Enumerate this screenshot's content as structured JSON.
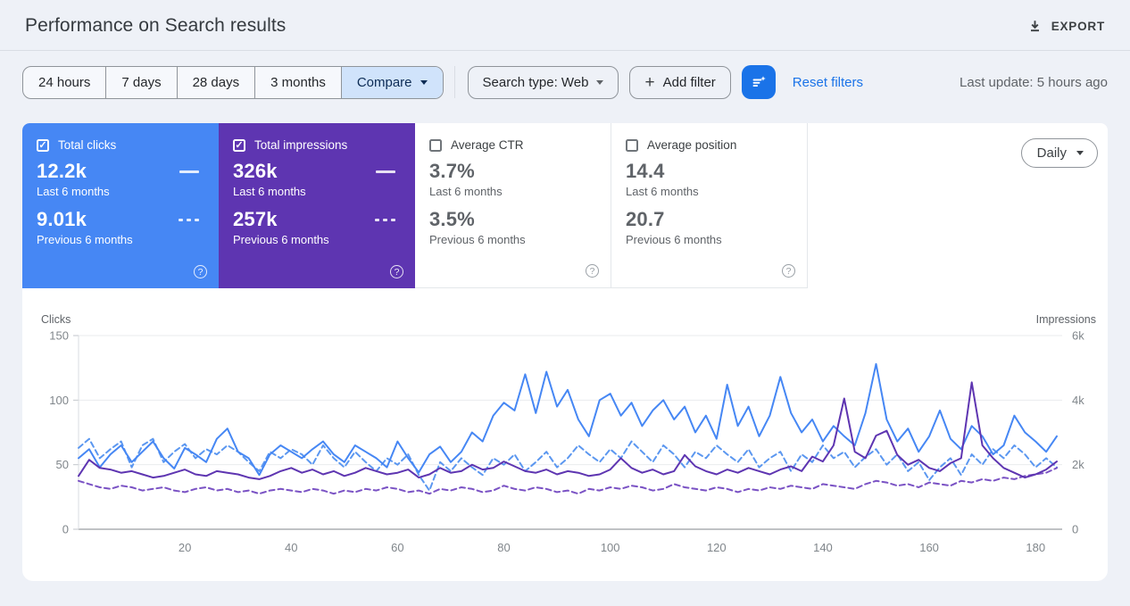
{
  "header": {
    "title": "Performance on Search results",
    "export_label": "EXPORT"
  },
  "filters": {
    "date_ranges": [
      "24 hours",
      "7 days",
      "28 days",
      "3 months"
    ],
    "compare_label": "Compare",
    "search_type_label": "Search type: Web",
    "add_filter_label": "Add filter",
    "reset_label": "Reset filters",
    "last_update": "Last update: 5 hours ago"
  },
  "granularity": {
    "label": "Daily"
  },
  "cards": [
    {
      "label": "Total clicks",
      "checked": true,
      "color": "#4687f4",
      "value_current": "12.2k",
      "period_current": "Last 6 months",
      "value_previous": "9.01k",
      "period_previous": "Previous 6 months"
    },
    {
      "label": "Total impressions",
      "checked": true,
      "color": "#5e35b1",
      "value_current": "326k",
      "period_current": "Last 6 months",
      "value_previous": "257k",
      "period_previous": "Previous 6 months"
    },
    {
      "label": "Average CTR",
      "checked": false,
      "value_current": "3.7%",
      "period_current": "Last 6 months",
      "value_previous": "3.5%",
      "period_previous": "Previous 6 months"
    },
    {
      "label": "Average position",
      "checked": false,
      "value_current": "14.4",
      "period_current": "Last 6 months",
      "value_previous": "20.7",
      "period_previous": "Previous 6 months"
    }
  ],
  "chart_data": {
    "type": "line",
    "left_axis": {
      "title": "Clicks",
      "ticks": [
        "0",
        "50",
        "100",
        "150"
      ],
      "range": [
        0,
        150
      ]
    },
    "right_axis": {
      "title": "Impressions",
      "ticks": [
        "0",
        "2k",
        "4k",
        "6k"
      ],
      "range": [
        0,
        6000
      ]
    },
    "x_ticks": [
      20,
      40,
      60,
      80,
      100,
      120,
      140,
      160,
      180
    ],
    "x_range": [
      0,
      185
    ],
    "grid": true,
    "series": [
      {
        "name": "Clicks - Last 6 months",
        "axis": "left",
        "style": "solid",
        "color": "#4687f4",
        "x_step": 2,
        "values": [
          55,
          62,
          48,
          58,
          65,
          52,
          60,
          68,
          55,
          47,
          63,
          58,
          52,
          70,
          78,
          60,
          55,
          42,
          58,
          65,
          60,
          55,
          62,
          68,
          58,
          52,
          65,
          60,
          55,
          48,
          68,
          55,
          44,
          58,
          64,
          52,
          60,
          75,
          68,
          88,
          98,
          92,
          120,
          90,
          122,
          95,
          108,
          85,
          72,
          100,
          105,
          88,
          98,
          80,
          92,
          100,
          85,
          95,
          75,
          88,
          70,
          112,
          80,
          95,
          72,
          88,
          118,
          90,
          75,
          85,
          68,
          80,
          72,
          65,
          90,
          128,
          85,
          68,
          78,
          60,
          72,
          92,
          70,
          62,
          80,
          72,
          58,
          65,
          88,
          75,
          68,
          60,
          72
        ]
      },
      {
        "name": "Clicks - Previous 6 months",
        "axis": "left",
        "style": "dashed",
        "color": "#5b97f0",
        "x_step": 2,
        "values": [
          63,
          70,
          55,
          62,
          68,
          48,
          65,
          70,
          52,
          60,
          66,
          55,
          62,
          58,
          65,
          60,
          52,
          45,
          60,
          55,
          62,
          58,
          50,
          65,
          55,
          48,
          60,
          52,
          45,
          55,
          50,
          58,
          42,
          30,
          52,
          45,
          55,
          48,
          42,
          55,
          50,
          58,
          45,
          52,
          60,
          48,
          55,
          65,
          58,
          52,
          62,
          55,
          68,
          60,
          52,
          65,
          58,
          48,
          60,
          55,
          65,
          58,
          52,
          62,
          48,
          55,
          60,
          45,
          58,
          52,
          65,
          55,
          60,
          48,
          56,
          62,
          50,
          58,
          45,
          52,
          38,
          48,
          55,
          42,
          58,
          50,
          62,
          55,
          65,
          58,
          48,
          55,
          48
        ]
      },
      {
        "name": "Impressions - Last 6 months",
        "axis": "right",
        "style": "solid",
        "color": "#5e35b1",
        "x_step": 2,
        "values": [
          1650,
          2150,
          1900,
          1850,
          1750,
          1800,
          1700,
          1600,
          1650,
          1750,
          1850,
          1700,
          1650,
          1800,
          1750,
          1700,
          1600,
          1550,
          1650,
          1800,
          1900,
          1750,
          1850,
          1700,
          1800,
          1650,
          1750,
          1900,
          1800,
          1700,
          1750,
          1850,
          1600,
          1700,
          1900,
          1750,
          1800,
          2000,
          1850,
          1900,
          2100,
          1950,
          1800,
          1750,
          1850,
          1700,
          1800,
          1750,
          1650,
          1700,
          1850,
          2200,
          1900,
          1750,
          1850,
          1700,
          1800,
          2300,
          1950,
          1800,
          1700,
          1850,
          1750,
          1900,
          1800,
          1700,
          1850,
          1950,
          1800,
          2250,
          2100,
          2600,
          4050,
          2400,
          2200,
          2900,
          3050,
          2300,
          2000,
          2150,
          1900,
          1800,
          2050,
          2200,
          4550,
          2600,
          2200,
          1900,
          1750,
          1600,
          1700,
          1850,
          2100
        ]
      },
      {
        "name": "Impressions - Previous 6 months",
        "axis": "right",
        "style": "dashed",
        "color": "#7a52c4",
        "x_step": 2,
        "values": [
          1500,
          1400,
          1300,
          1250,
          1350,
          1300,
          1200,
          1250,
          1300,
          1200,
          1150,
          1250,
          1300,
          1200,
          1250,
          1150,
          1200,
          1100,
          1200,
          1250,
          1200,
          1150,
          1250,
          1200,
          1100,
          1200,
          1150,
          1250,
          1200,
          1300,
          1250,
          1150,
          1200,
          1100,
          1250,
          1200,
          1300,
          1250,
          1150,
          1200,
          1350,
          1250,
          1200,
          1300,
          1250,
          1150,
          1200,
          1100,
          1250,
          1200,
          1300,
          1250,
          1350,
          1300,
          1200,
          1250,
          1400,
          1300,
          1250,
          1200,
          1300,
          1250,
          1150,
          1250,
          1200,
          1300,
          1250,
          1350,
          1300,
          1250,
          1400,
          1350,
          1300,
          1250,
          1400,
          1500,
          1450,
          1350,
          1400,
          1300,
          1450,
          1400,
          1350,
          1500,
          1450,
          1550,
          1500,
          1600,
          1550,
          1650,
          1700,
          1750,
          1900
        ]
      }
    ]
  }
}
